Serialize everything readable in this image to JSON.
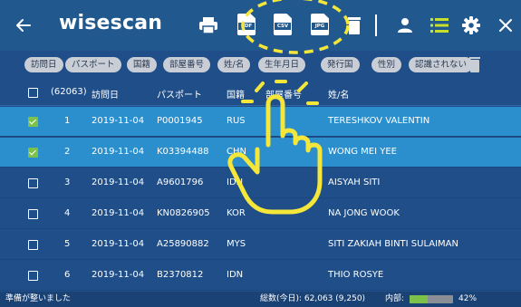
{
  "app": {
    "title": "wisescan"
  },
  "toolbar": {
    "pdf_label": "PDF",
    "csv_label": "CSV",
    "jpg_label": "JPG"
  },
  "filter_chips": [
    "訪問日",
    "パスポート",
    "国籍",
    "部屋番号",
    "姓/名",
    "生年月日",
    "発行国",
    "性別",
    "認識されない"
  ],
  "table": {
    "total_count": "(62063)",
    "columns": {
      "date": "訪問日",
      "passport": "パスポート",
      "nationality": "国籍",
      "room": "部屋番号",
      "name": "姓/名"
    },
    "rows": [
      {
        "num": "1",
        "date": "2019-11-04",
        "passport": "P0001945",
        "nationality": "RUS",
        "name": "TERESHKOV VALENTIN",
        "checked": true
      },
      {
        "num": "2",
        "date": "2019-11-04",
        "passport": "K03394488",
        "nationality": "CHN",
        "name": "WONG MEI YEE",
        "checked": true
      },
      {
        "num": "3",
        "date": "2019-11-04",
        "passport": "A9601796",
        "nationality": "IDN",
        "name": "AISYAH SITI",
        "checked": false
      },
      {
        "num": "4",
        "date": "2019-11-04",
        "passport": "KN0826905",
        "nationality": "KOR",
        "name": "NA JONG WOOK",
        "checked": false
      },
      {
        "num": "5",
        "date": "2019-11-04",
        "passport": "A25890882",
        "nationality": "MYS",
        "name": "SITI ZAKIAH BINTI SULAIMAN",
        "checked": false
      },
      {
        "num": "6",
        "date": "2019-11-04",
        "passport": "B2370812",
        "nationality": "IDN",
        "name": "THIO ROSYE",
        "checked": false
      }
    ]
  },
  "status": {
    "ready": "準備が整いました",
    "total": "総数(今日): 62,063 (9,250)",
    "storage_label": "内部:",
    "storage_percent": "42%",
    "storage_fraction": 0.42
  },
  "colors": {
    "topbar": "#21598f",
    "background": "#1f4e88",
    "selected_row": "#2b8fcd",
    "accent_green": "#7cc24a",
    "overlay_yellow": "#f5e63a"
  },
  "icons": [
    "back-arrow-icon",
    "printer-icon",
    "pdf-file-icon",
    "csv-file-icon",
    "jpg-file-icon",
    "trash-icon",
    "person-icon",
    "list-icon",
    "gear-icon",
    "close-icon",
    "tap-hand-icon"
  ]
}
